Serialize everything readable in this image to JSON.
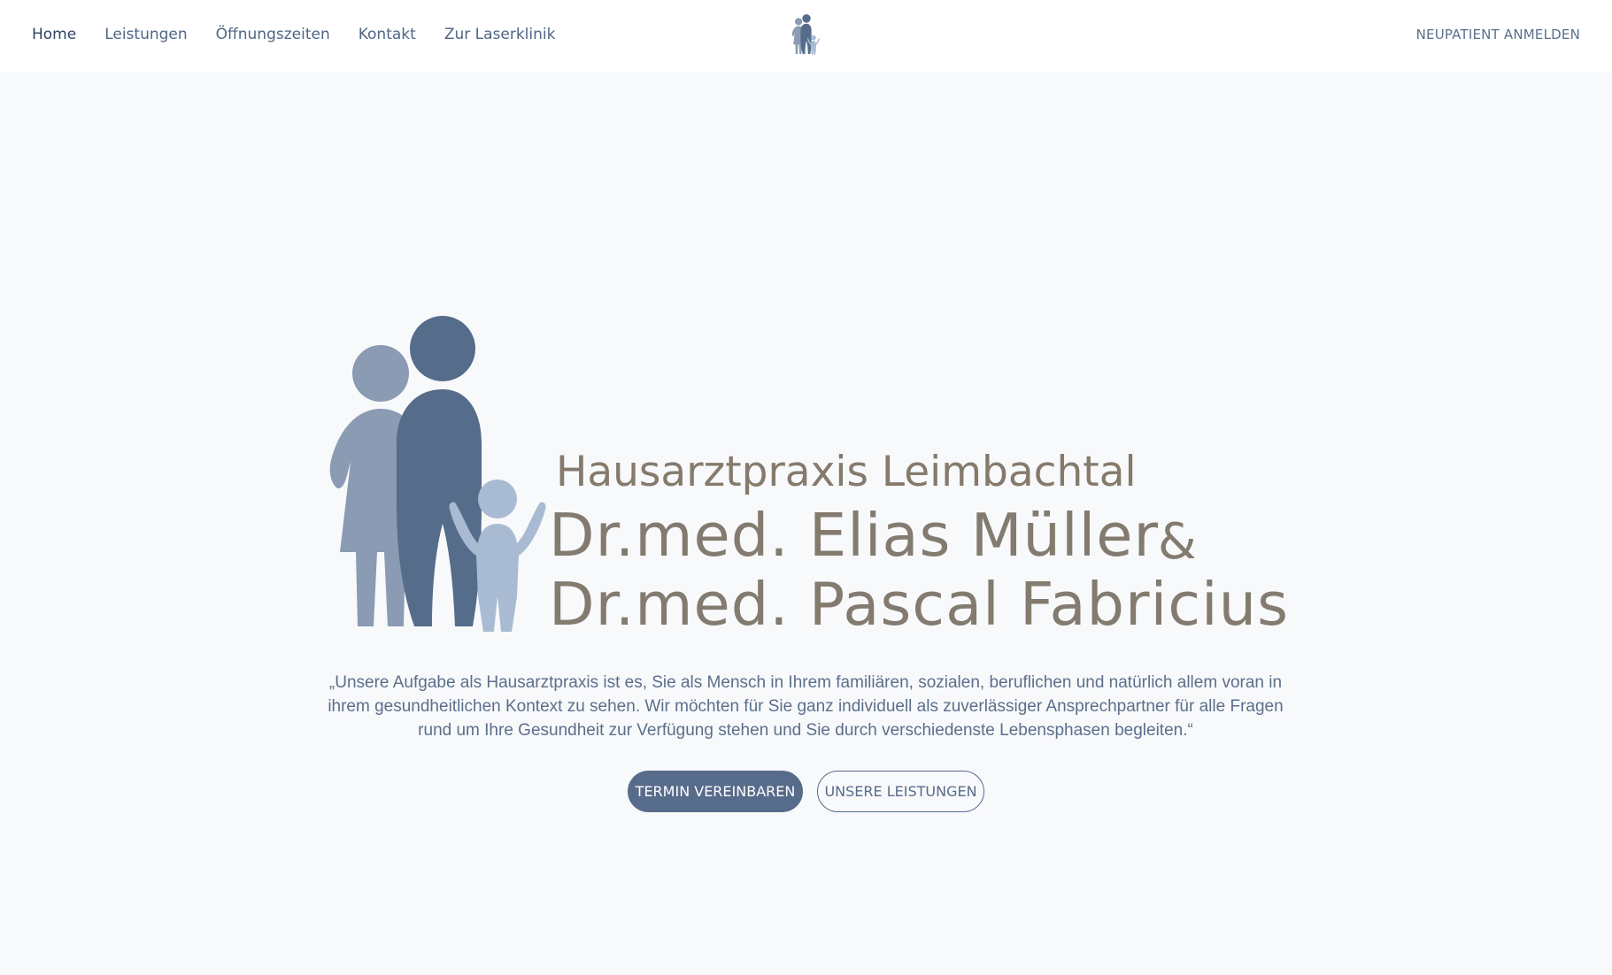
{
  "nav": {
    "links": [
      "Home",
      "Leistungen",
      "Öffnungszeiten",
      "Kontakt",
      "Zur Laserklinik"
    ],
    "active": "Home",
    "cta": "NEUPATIENT ANMELDEN",
    "logo_icon": "family-logo-icon"
  },
  "hero": {
    "practice_name": "Hausarztpraxis Leimbachtal",
    "doctor_1": "Dr.med. Elias Müller",
    "ampersand": "&",
    "doctor_2": "Dr.med. Pascal Fabricius",
    "quote": "„Unsere Aufgabe als Hausarztpraxis ist es, Sie als Mensch in Ihrem familiären, sozialen, beruflichen und natürlich allem voran in ihrem gesundheitlichen Kontext zu sehen. Wir möchten für Sie ganz individuell als zuverlässiger Ansprechpartner für alle Fragen rund um Ihre Gesundheit zur Verfügung stehen und Sie durch verschiedenste Lebensphasen begleiten.“",
    "primary_button": "TERMIN VEREINBAREN",
    "secondary_button": "UNSERE LEISTUNGEN"
  },
  "colors": {
    "background": "#f8f9fb",
    "navbar": "#ffffff",
    "accent": "#576b8a",
    "brand_text": "#837b6f",
    "figure_dark": "#566c8b",
    "figure_mid": "#8a9bb3",
    "figure_light": "#a9bbd3"
  }
}
